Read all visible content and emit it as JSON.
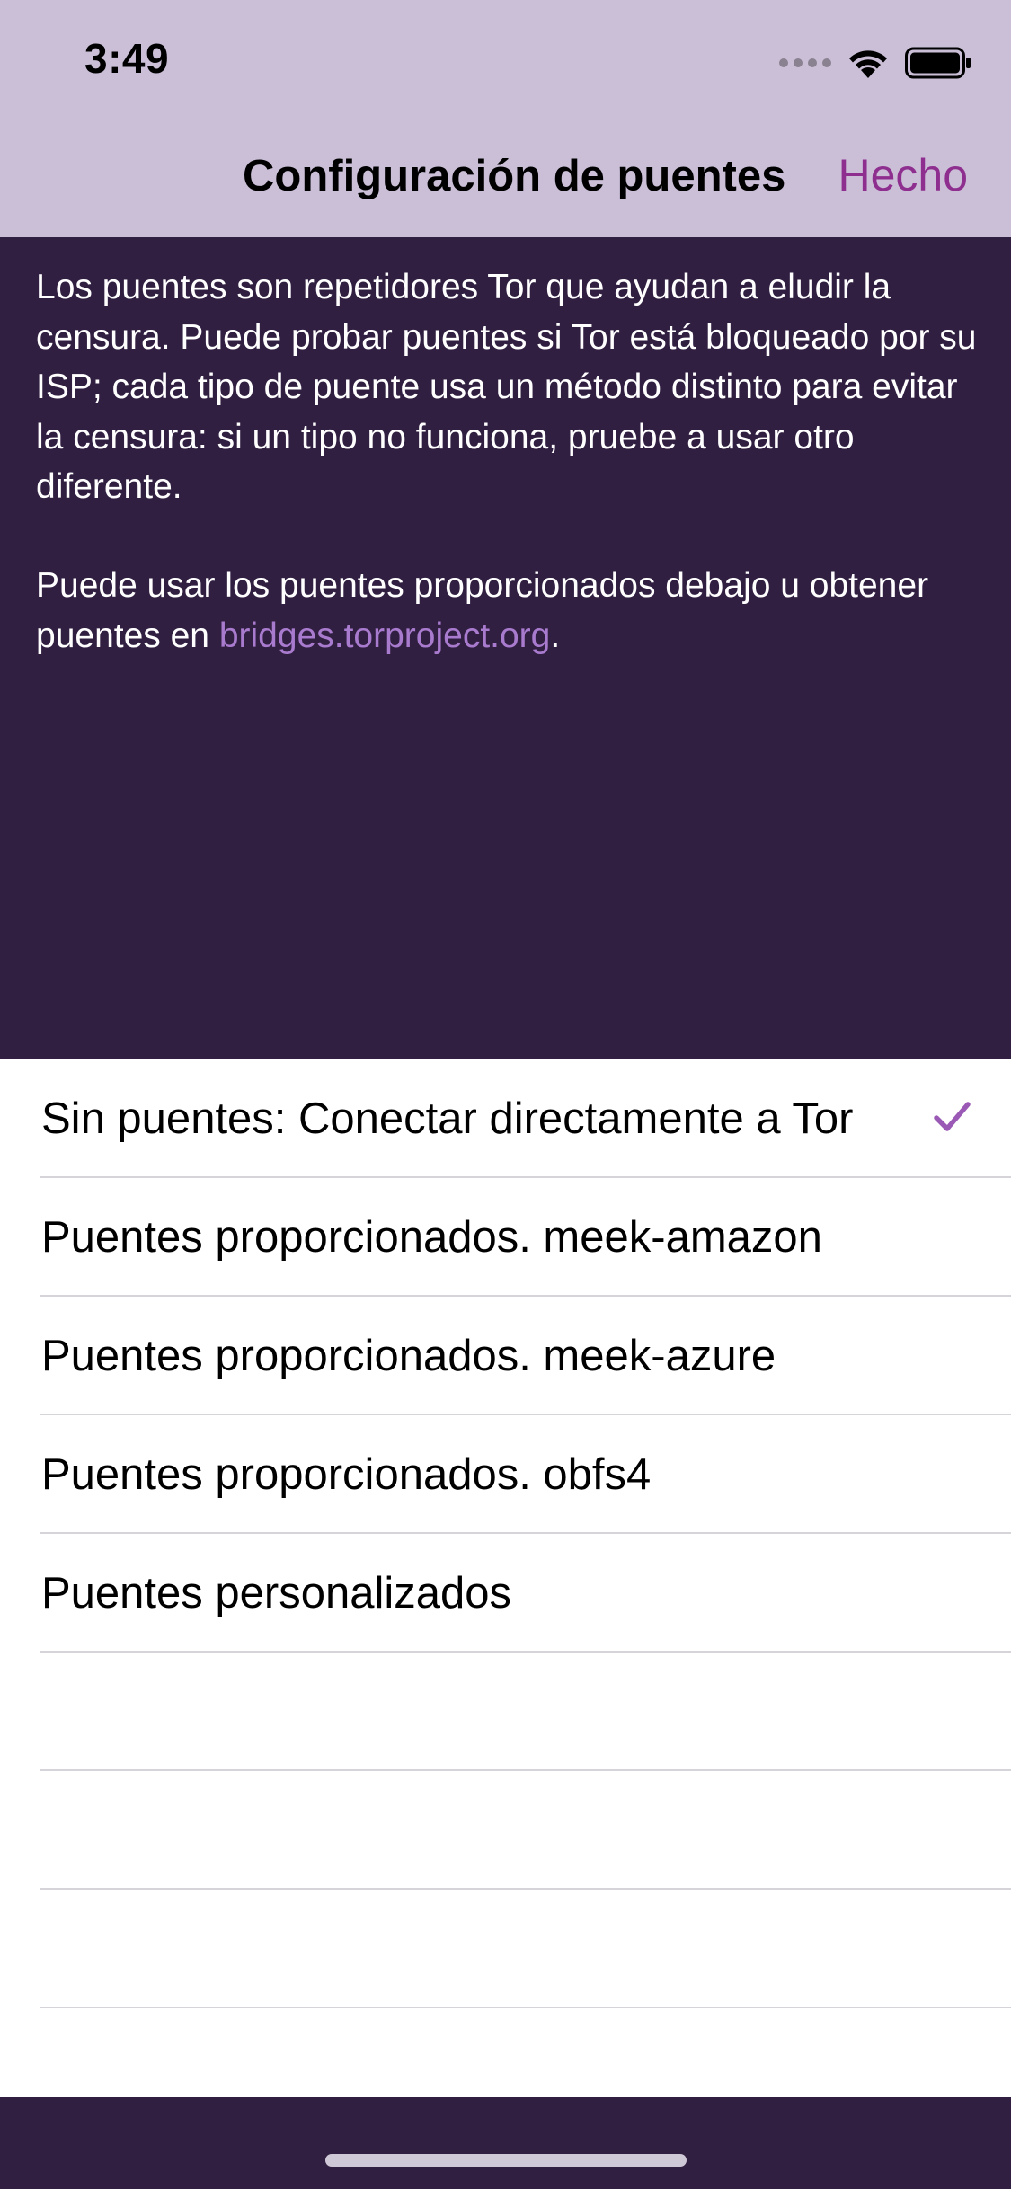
{
  "status_bar": {
    "time": "3:49",
    "icons": [
      "signal-dots-icon",
      "wifi-icon",
      "battery-icon"
    ]
  },
  "nav": {
    "title": "Configuración de puentes",
    "done_label": "Hecho"
  },
  "info": {
    "paragraph1": "Los puentes son repetidores Tor que ayudan a eludir la censura. Puede probar puentes si Tor está bloqueado por su ISP; cada tipo de puente usa un método distinto para evitar la censura: si un tipo no funciona, pruebe a usar otro diferente.",
    "paragraph2_prefix": "Puede usar los puentes proporcionados debajo u obtener puentes en ",
    "paragraph2_link": "bridges.torproject.org",
    "paragraph2_suffix": "."
  },
  "options": {
    "items": [
      {
        "label": "Sin puentes: Conectar directamente a Tor",
        "selected": true
      },
      {
        "label": "Puentes proporcionados. meek-amazon",
        "selected": false
      },
      {
        "label": "Puentes proporcionados. meek-azure",
        "selected": false
      },
      {
        "label": "Puentes proporcionados. obfs4",
        "selected": false
      },
      {
        "label": "Puentes personalizados",
        "selected": false
      }
    ]
  },
  "colors": {
    "accent": "#8e2f8f",
    "link": "#a97bcf",
    "checkmark": "#9b59b6",
    "background_dark": "#311f41",
    "navbar": "#cbbfd8"
  }
}
